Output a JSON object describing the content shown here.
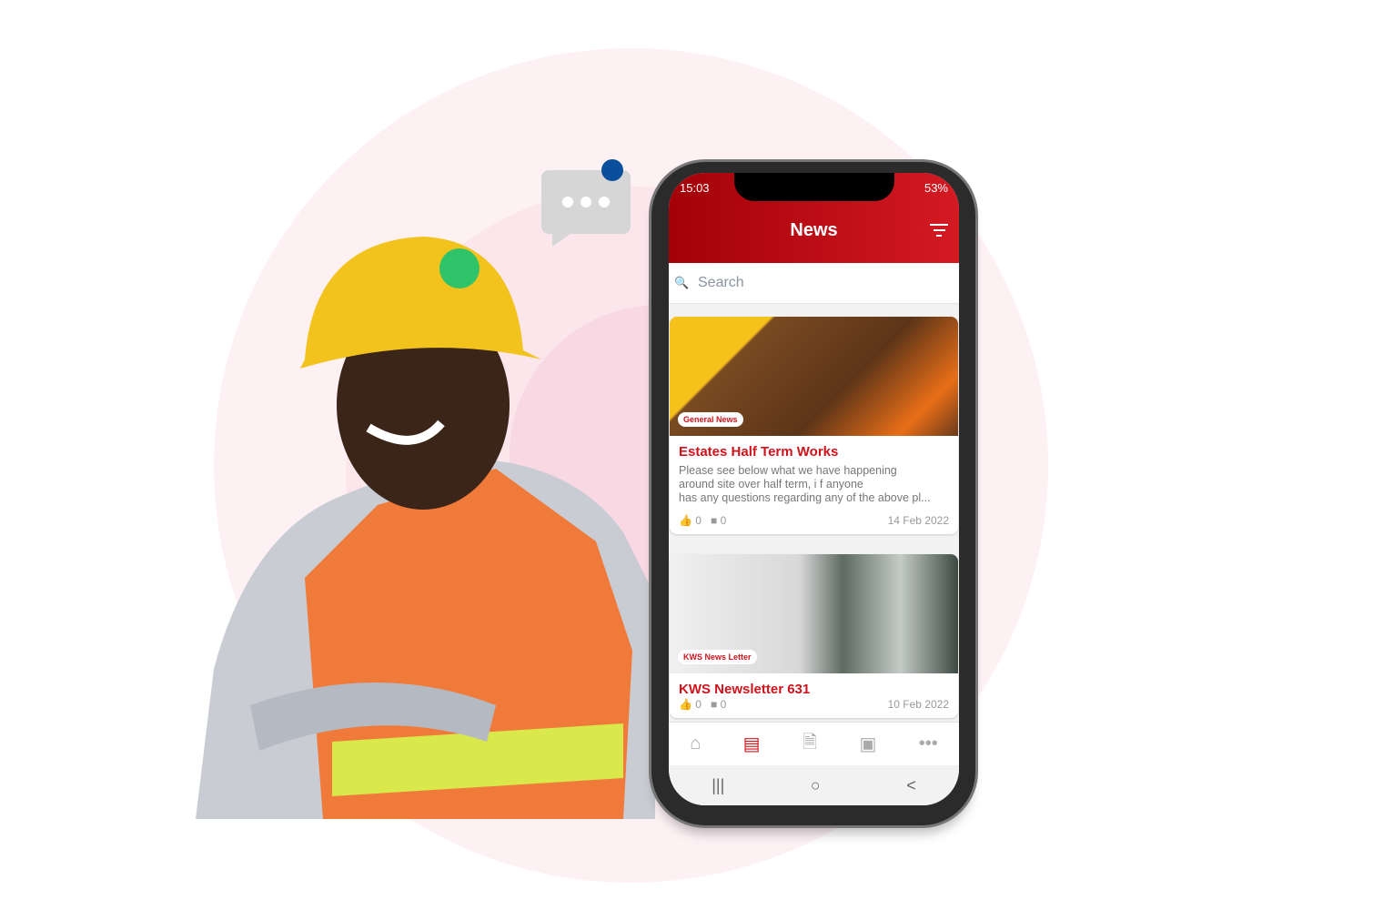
{
  "colors": {
    "brand": "#d0121b",
    "accent_dot": "#0a4f9c",
    "background_circle": "#fdf1f4"
  },
  "status": {
    "time": "15:03",
    "battery": "53%"
  },
  "header": {
    "title": "News",
    "filter_icon": "filter-icon"
  },
  "search": {
    "placeholder": "Search"
  },
  "cards": [
    {
      "tag": "General News",
      "title": "Estates Half Term Works",
      "excerpt": [
        "Please see below what we have happening",
        "around site over half term, i f anyone",
        "has any questions regarding any of the above pl..."
      ],
      "likes": "0",
      "comments": "0",
      "date": "14 Feb 2022"
    },
    {
      "tag": "KWS News Letter",
      "title": "KWS Newsletter 631",
      "likes": "0",
      "comments": "0",
      "date": "10 Feb 2022"
    }
  ],
  "tabbar": {
    "icons": [
      "home-icon",
      "news-icon",
      "document-icon",
      "contact-icon",
      "more-icon"
    ],
    "active": "news-icon"
  },
  "navbar": {
    "recents": "|||",
    "home": "○",
    "back": "<"
  }
}
